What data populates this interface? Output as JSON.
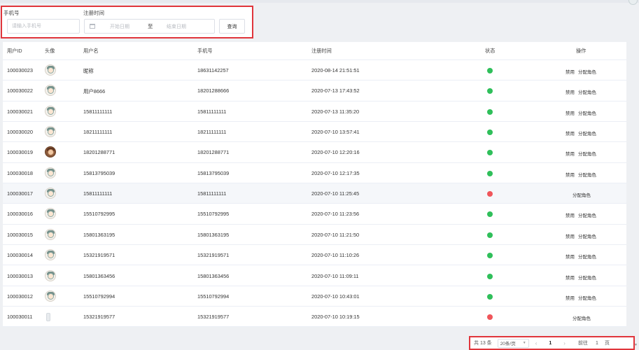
{
  "filters": {
    "phone_label": "手机号",
    "phone_placeholder": "请输入手机号",
    "reg_label": "注册时间",
    "start_placeholder": "开始日期",
    "range_sep": "至",
    "end_placeholder": "结束日期",
    "search_label": "查询"
  },
  "table": {
    "headers": {
      "id": "用户ID",
      "avatar": "头像",
      "name": "用户名",
      "phone": "手机号",
      "time": "注册时间",
      "status": "状态",
      "ops": "操作"
    },
    "rows": [
      {
        "id": "100030023",
        "name": "昵称",
        "phone": "18631142257",
        "time": "2020-08-14 21:51:51",
        "status": "green",
        "ops": [
          "禁用",
          "分配角色"
        ]
      },
      {
        "id": "100030022",
        "name": "用户8666",
        "phone": "18201288666",
        "time": "2020-07-13 17:43:52",
        "status": "green",
        "ops": [
          "禁用",
          "分配角色"
        ]
      },
      {
        "id": "100030021",
        "name": "15811111111",
        "phone": "15811111111",
        "time": "2020-07-13 11:35:20",
        "status": "green",
        "ops": [
          "禁用",
          "分配角色"
        ]
      },
      {
        "id": "100030020",
        "name": "18211111111",
        "phone": "18211111111",
        "time": "2020-07-10 13:57:41",
        "status": "green",
        "ops": [
          "禁用",
          "分配角色"
        ]
      },
      {
        "id": "100030019",
        "name": "18201288771",
        "phone": "18201288771",
        "time": "2020-07-10 12:20:16",
        "status": "green",
        "ops": [
          "禁用",
          "分配角色"
        ]
      },
      {
        "id": "100030018",
        "name": "15813795039",
        "phone": "15813795039",
        "time": "2020-07-10 12:17:35",
        "status": "green",
        "ops": [
          "禁用",
          "分配角色"
        ]
      },
      {
        "id": "100030017",
        "name": "15811111111",
        "phone": "15811111111",
        "time": "2020-07-10 11:25:45",
        "status": "red",
        "ops": [
          "分配角色"
        ]
      },
      {
        "id": "100030016",
        "name": "15510792995",
        "phone": "15510792995",
        "time": "2020-07-10 11:23:56",
        "status": "green",
        "ops": [
          "禁用",
          "分配角色"
        ]
      },
      {
        "id": "100030015",
        "name": "15801363195",
        "phone": "15801363195",
        "time": "2020-07-10 11:21:50",
        "status": "green",
        "ops": [
          "禁用",
          "分配角色"
        ]
      },
      {
        "id": "100030014",
        "name": "15321919571",
        "phone": "15321919571",
        "time": "2020-07-10 11:10:26",
        "status": "green",
        "ops": [
          "禁用",
          "分配角色"
        ]
      },
      {
        "id": "100030013",
        "name": "15801363456",
        "phone": "15801363456",
        "time": "2020-07-10 11:09:11",
        "status": "green",
        "ops": [
          "禁用",
          "分配角色"
        ]
      },
      {
        "id": "100030012",
        "name": "15510792994",
        "phone": "15510792994",
        "time": "2020-07-10 10:43:01",
        "status": "green",
        "ops": [
          "禁用",
          "分配角色"
        ]
      },
      {
        "id": "100030011",
        "name": "15321919577",
        "phone": "15321919577",
        "time": "2020-07-10 10:19:15",
        "status": "red",
        "ops": [
          "分配角色"
        ]
      }
    ]
  },
  "pager": {
    "total": "共 13 条",
    "page_size": "20条/页",
    "prev": "‹",
    "current": "1",
    "next": "›",
    "goto_label": "前往",
    "goto_value": "1",
    "page_suffix": "页"
  },
  "colors": {
    "status_green": "#2fbf5a",
    "status_red": "#f0555a",
    "highlight_border": "#e0353b"
  }
}
